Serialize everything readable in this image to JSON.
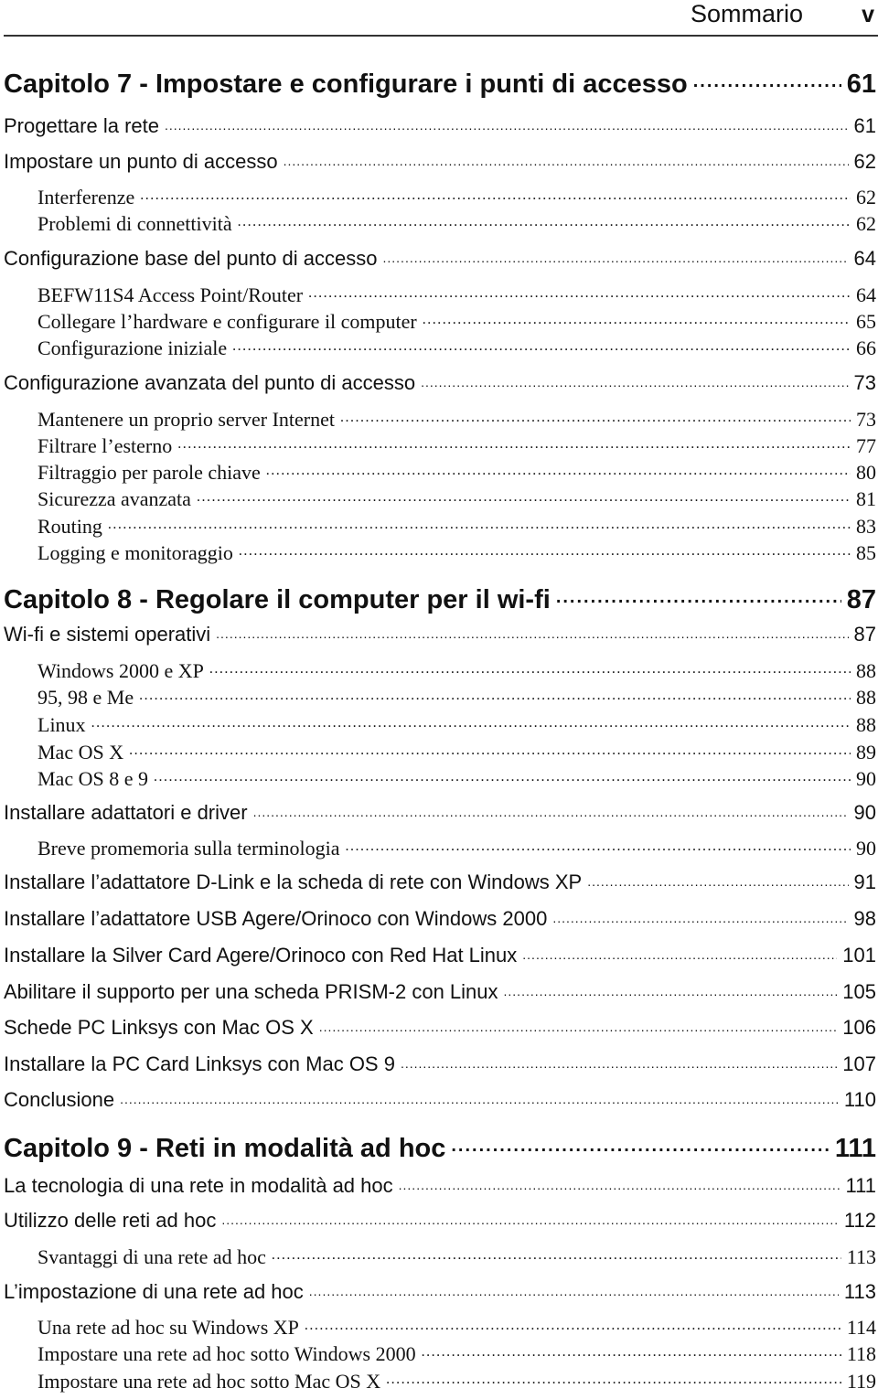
{
  "header": {
    "title": "Sommario",
    "page_number": "v"
  },
  "toc": [
    {
      "level": "chapter",
      "label": "Capitolo 7 - Impostare e configurare i punti di accesso",
      "page": "61"
    },
    {
      "level": "section",
      "label": "Progettare la rete",
      "page": "61"
    },
    {
      "level": "section",
      "label": "Impostare un punto di accesso",
      "page": "62"
    },
    {
      "level": "sub",
      "label": "Interferenze",
      "page": "62"
    },
    {
      "level": "sub",
      "label": "Problemi di connettività",
      "page": "62"
    },
    {
      "level": "section",
      "label": "Configurazione base del punto di accesso",
      "page": "64"
    },
    {
      "level": "sub",
      "label": "BEFW11S4 Access Point/Router",
      "page": "64"
    },
    {
      "level": "sub",
      "label": "Collegare l’hardware e configurare il computer",
      "page": "65"
    },
    {
      "level": "sub",
      "label": "Configurazione iniziale",
      "page": "66"
    },
    {
      "level": "section",
      "label": "Configurazione avanzata del punto di accesso",
      "page": "73"
    },
    {
      "level": "sub",
      "label": "Mantenere un proprio server Internet",
      "page": "73"
    },
    {
      "level": "sub",
      "label": "Filtrare l’esterno",
      "page": "77"
    },
    {
      "level": "sub",
      "label": "Filtraggio per parole chiave",
      "page": "80"
    },
    {
      "level": "sub",
      "label": "Sicurezza avanzata",
      "page": "81"
    },
    {
      "level": "sub",
      "label": "Routing",
      "page": "83"
    },
    {
      "level": "sub",
      "label": "Logging e monitoraggio",
      "page": "85"
    },
    {
      "level": "chapter",
      "label": "Capitolo 8 - Regolare il computer per il wi-fi",
      "page": "87"
    },
    {
      "level": "section",
      "label": "Wi-fi e sistemi operativi",
      "page": "87"
    },
    {
      "level": "sub",
      "label": "Windows 2000 e XP",
      "page": "88"
    },
    {
      "level": "sub",
      "label": "95, 98 e Me",
      "page": "88"
    },
    {
      "level": "sub",
      "label": "Linux",
      "page": "88"
    },
    {
      "level": "sub",
      "label": "Mac OS X",
      "page": "89"
    },
    {
      "level": "sub",
      "label": "Mac OS 8 e 9",
      "page": "90"
    },
    {
      "level": "section",
      "label": "Installare adattatori e driver",
      "page": "90"
    },
    {
      "level": "sub",
      "label": "Breve promemoria sulla terminologia",
      "page": "90"
    },
    {
      "level": "section",
      "label": "Installare l’adattatore D-Link e la scheda di rete con Windows XP",
      "page": "91"
    },
    {
      "level": "section",
      "label": "Installare l’adattatore USB Agere/Orinoco con Windows 2000",
      "page": "98"
    },
    {
      "level": "section",
      "label": "Installare la Silver Card Agere/Orinoco con Red Hat Linux",
      "page": "101"
    },
    {
      "level": "section",
      "label": "Abilitare il supporto per una scheda PRISM-2 con Linux",
      "page": "105"
    },
    {
      "level": "section",
      "label": "Schede PC Linksys con Mac OS X",
      "page": "106"
    },
    {
      "level": "section",
      "label": "Installare la PC Card Linksys con Mac OS 9",
      "page": "107"
    },
    {
      "level": "section",
      "label": "Conclusione",
      "page": "110"
    },
    {
      "level": "chapter",
      "label": "Capitolo 9 - Reti in modalità ad hoc",
      "page": "111"
    },
    {
      "level": "section",
      "label": "La tecnologia di una rete in modalità ad hoc",
      "page": "111"
    },
    {
      "level": "section",
      "label": "Utilizzo delle reti ad hoc",
      "page": "112"
    },
    {
      "level": "sub",
      "label": "Svantaggi di una rete ad hoc",
      "page": "113"
    },
    {
      "level": "section",
      "label": "L’impostazione di una rete ad hoc",
      "page": "113"
    },
    {
      "level": "sub",
      "label": "Una rete ad hoc su Windows XP",
      "page": "114"
    },
    {
      "level": "sub",
      "label": "Impostare una rete ad hoc sotto Windows 2000",
      "page": "118"
    },
    {
      "level": "sub",
      "label": "Impostare una rete ad hoc sotto Mac OS X",
      "page": "119"
    }
  ]
}
